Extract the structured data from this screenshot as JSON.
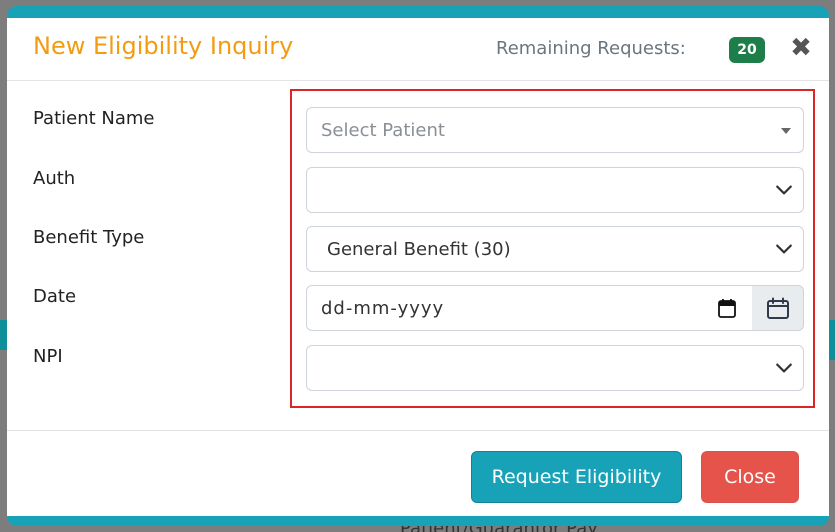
{
  "modal": {
    "title": "New Eligibility Inquiry",
    "remaining_label": "Remaining Requests:",
    "remaining_count": "20",
    "close_icon": "close-icon"
  },
  "form": {
    "labels": {
      "patient_name": "Patient Name",
      "auth": "Auth",
      "benefit_type": "Benefit Type",
      "date": "Date",
      "npi": "NPI"
    },
    "patient_select": {
      "placeholder": "Select Patient",
      "value": ""
    },
    "auth_select": {
      "value": ""
    },
    "benefit_type_select": {
      "value": "General Benefit (30)"
    },
    "date_input": {
      "placeholder": "dd-mm-yyyy",
      "value": ""
    },
    "npi_select": {
      "value": ""
    }
  },
  "footer": {
    "request_button": "Request Eligibility",
    "close_button": "Close"
  },
  "backdrop": {
    "bottom_text": "Patient/Guarantor Pay"
  },
  "colors": {
    "title": "#f39c12",
    "accent": "#17a2b8",
    "badge": "#1e7e4a",
    "close_button": "#e5534b",
    "highlight": "#dc2626"
  }
}
